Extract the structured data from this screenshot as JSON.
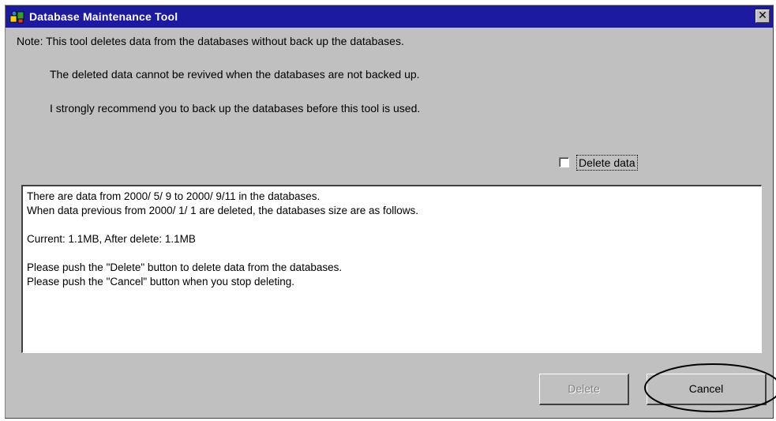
{
  "window": {
    "title": "Database Maintenance Tool",
    "close_glyph": "✕"
  },
  "notes": {
    "line1": "Note: This tool deletes data from the databases without back up the databases.",
    "line2": "The deleted data cannot be revived when the databases are not backed up.",
    "line3": "I strongly recommend you to back up the databases before this tool is used."
  },
  "checkbox": {
    "label": "Delete data",
    "checked": false
  },
  "message": {
    "line1": "There are data from 2000/ 5/ 9 to 2000/ 9/11 in the databases.",
    "line2": "When data previous from 2000/ 1/ 1 are deleted, the databases size are as follows.",
    "line3": "Current:  1.1MB,   After delete:  1.1MB",
    "line4": "Please push the \"Delete\" button to delete data from the databases.",
    "line5": "Please push the \"Cancel\" button when you stop deleting."
  },
  "buttons": {
    "delete_label": "Delete",
    "delete_enabled": false,
    "cancel_label": "Cancel"
  },
  "colors": {
    "titlebar": "#1c1aa0",
    "dialog_bg": "#c0c0c0"
  }
}
